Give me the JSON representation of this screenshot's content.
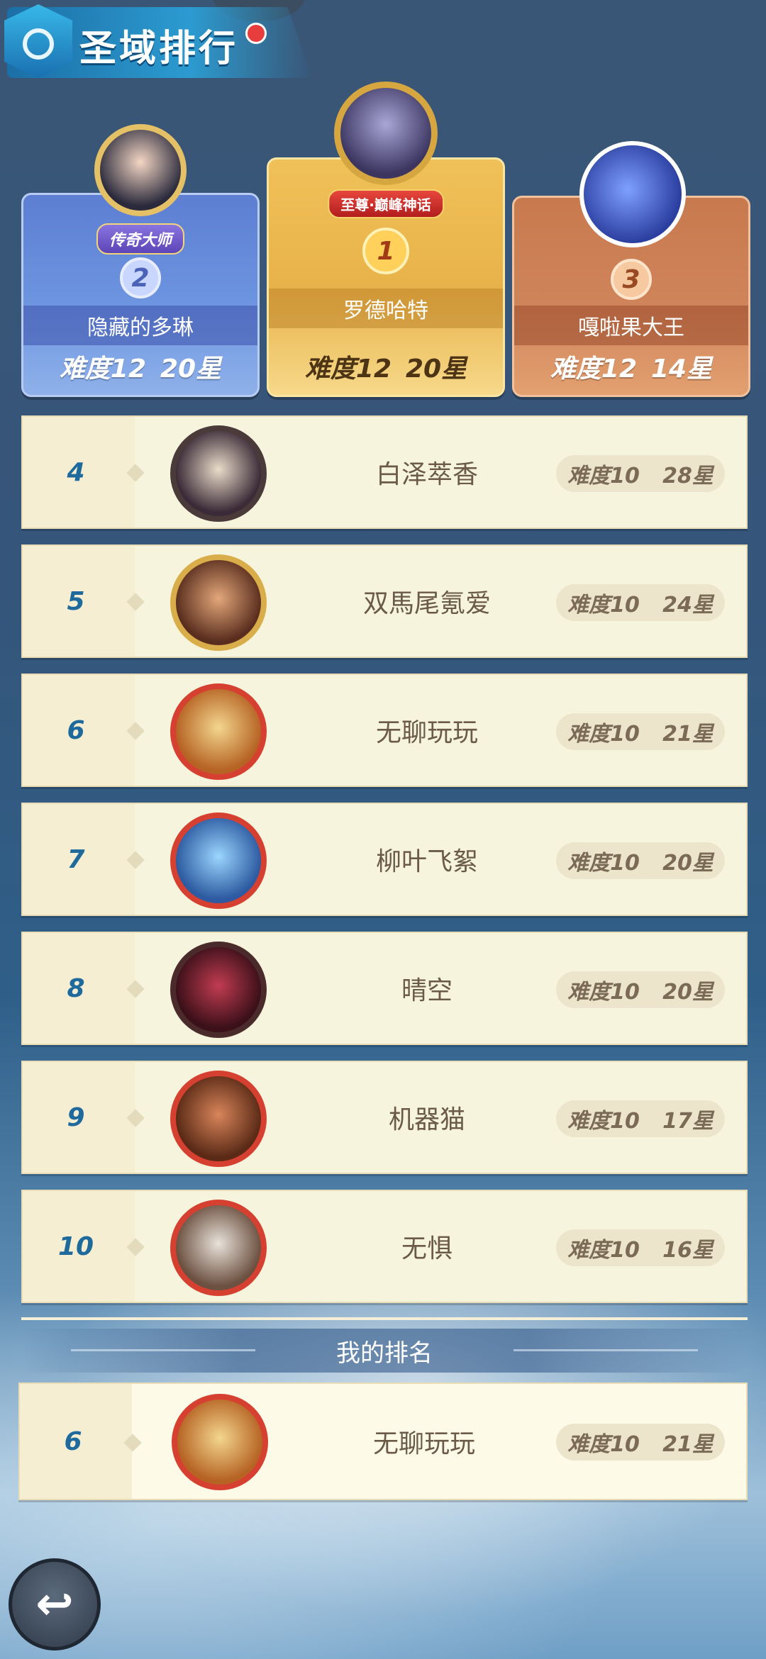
{
  "header": {
    "title": "圣域排行",
    "icon": "shield-emblem-icon"
  },
  "podium": [
    {
      "rank": "2",
      "name": "隐藏的多琳",
      "difficulty": "难度12",
      "stars": "20星",
      "title_badge": "传奇大师",
      "color": "#6d95e0"
    },
    {
      "rank": "1",
      "name": "罗德哈特",
      "difficulty": "难度12",
      "stars": "20星",
      "title_badge": "至尊·巅峰神话",
      "color": "#e8b24a"
    },
    {
      "rank": "3",
      "name": "嘎啦果大王",
      "difficulty": "难度12",
      "stars": "14星",
      "color": "#d0845a"
    }
  ],
  "rankings": [
    {
      "rank": "4",
      "name": "白泽萃香",
      "difficulty": "难度10",
      "stars": "28星"
    },
    {
      "rank": "5",
      "name": "双馬尾氪爱",
      "difficulty": "难度10",
      "stars": "24星"
    },
    {
      "rank": "6",
      "name": "无聊玩玩",
      "difficulty": "难度10",
      "stars": "21星"
    },
    {
      "rank": "7",
      "name": "柳叶飞絮",
      "difficulty": "难度10",
      "stars": "20星"
    },
    {
      "rank": "8",
      "name": "晴空",
      "difficulty": "难度10",
      "stars": "20星"
    },
    {
      "rank": "9",
      "name": "机器猫",
      "difficulty": "难度10",
      "stars": "17星"
    },
    {
      "rank": "10",
      "name": "无惧",
      "difficulty": "难度10",
      "stars": "16星"
    }
  ],
  "my_ranking": {
    "label": "我的排名",
    "rank": "6",
    "name": "无聊玩玩",
    "difficulty": "难度10",
    "stars": "21星"
  },
  "footer": {
    "back_icon": "back-arrow-icon"
  }
}
